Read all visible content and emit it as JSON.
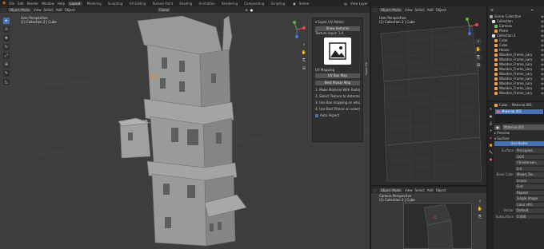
{
  "topbar": {
    "menus": [
      "File",
      "Edit",
      "Render",
      "Window",
      "Help"
    ],
    "workspaces": [
      "Layout",
      "Modeling",
      "Sculpting",
      "UV Editing",
      "Texture Paint",
      "Shading",
      "Animation",
      "Rendering",
      "Compositing",
      "Scripting"
    ],
    "active_workspace": "Layout",
    "scene_label": "Scene",
    "view_layer_label": "View Layer"
  },
  "viewport_left": {
    "mode": "Object Mode",
    "menu": [
      "View",
      "Select",
      "Add",
      "Object"
    ],
    "orientation": "Global",
    "view_name": "User Perspective",
    "collection_info": "(1) Collection 2 | Cube"
  },
  "addon_panel": {
    "title": "Super UV Addon",
    "show_textures_label": "Show textures",
    "texture_input_label": "Texture input: 1.0",
    "uv_mapping_label": "UV Mapping",
    "uv_box_map_label": "UV Box Map",
    "best_planar_map_label": "Best Planar Map",
    "steps": [
      "1. Make Material With Radial Text...",
      "2. Select Texture to determine Tex...",
      "3. Use Box mapping on whole objec...",
      "4. Use Best Planar on selected faces"
    ],
    "auto_aspect_label": "Auto Aspect",
    "tab_label": "Super UV"
  },
  "viewport_right_top": {
    "mode": "Object Mode",
    "menu": [
      "View",
      "Select",
      "Add",
      "Object"
    ],
    "view_name": "User Perspective",
    "collection_info": "(1) Collection 2 | Cube"
  },
  "viewport_right_bottom": {
    "mode": "Object Mode",
    "menu": [
      "View",
      "Select",
      "Add",
      "Object"
    ],
    "view_name": "Camera Perspective",
    "collection_info": "(1) Collection 2 | Cube"
  },
  "outliner": {
    "items": [
      {
        "label": "Scene Collection",
        "indent": 0,
        "color": "#a0a0a0"
      },
      {
        "label": "Collection",
        "indent": 1,
        "color": "#e0e0e0"
      },
      {
        "label": "Camera",
        "indent": 2,
        "color": "#6fbf6f"
      },
      {
        "label": "Plane",
        "indent": 2,
        "color": "#f29f4b"
      },
      {
        "label": "Collection 2",
        "indent": 1,
        "color": "#e0e0e0"
      },
      {
        "label": "Cube",
        "indent": 2,
        "color": "#f29f4b"
      },
      {
        "label": "Cube",
        "indent": 2,
        "color": "#f29f4b"
      },
      {
        "label": "House",
        "indent": 2,
        "color": "#f29f4b"
      },
      {
        "label": "Wooden_Frame_Lary",
        "indent": 2,
        "color": "#f29f4b"
      },
      {
        "label": "Wooden_Frame_Lary",
        "indent": 2,
        "color": "#f29f4b"
      },
      {
        "label": "Wooden_Frame_Lary",
        "indent": 2,
        "color": "#f29f4b"
      },
      {
        "label": "Wooden_Frame_Lary",
        "indent": 2,
        "color": "#f29f4b"
      },
      {
        "label": "Wooden_Frame_Lary",
        "indent": 2,
        "color": "#f29f4b"
      },
      {
        "label": "Wooden_Frame_Lary",
        "indent": 2,
        "color": "#f29f4b"
      },
      {
        "label": "Wooden_Frame_Lary",
        "indent": 2,
        "color": "#f29f4b"
      },
      {
        "label": "Wooden_Frame_Lary",
        "indent": 2,
        "color": "#f29f4b"
      },
      {
        "label": "Wooden_Frame_Lary",
        "indent": 2,
        "color": "#f29f4b"
      }
    ]
  },
  "properties": {
    "object_name": "Cube",
    "material_name": "Material.001",
    "slot_name": "Material.001",
    "sections": {
      "preview": "Preview",
      "surface": "Surface",
      "use_nodes": "Use Nodes"
    },
    "rows": [
      {
        "label": "Surface",
        "value": "Principled..."
      },
      {
        "label": "",
        "value": "GGX"
      },
      {
        "label": "",
        "value": "Christensen..."
      },
      {
        "label": "",
        "value": "0.0"
      },
      {
        "label": "Base Color",
        "value": "Mixed_Tex..."
      },
      {
        "label": "",
        "value": "Linear"
      },
      {
        "label": "",
        "value": "Flat"
      },
      {
        "label": "",
        "value": "Repeat"
      },
      {
        "label": "",
        "value": "Single Image"
      },
      {
        "label": "",
        "value": "Color  sRG"
      },
      {
        "label": "Vector",
        "value": "Default"
      },
      {
        "label": "Subsurface",
        "value": "0.000"
      }
    ]
  },
  "colors": {
    "accent": "#4772b3",
    "panel_bg": "#2b2b2b",
    "viewport_bg": "#3d3d3d",
    "object_orange": "#f29f4b"
  }
}
